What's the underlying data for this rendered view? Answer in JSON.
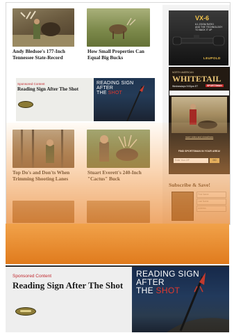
{
  "articles": [
    {
      "title": "Andy Bledsoe's 177-Inch Tennessee State-Record"
    },
    {
      "title": "How Small Properties Can Equal Big Bucks"
    },
    {
      "title": "Top Do's and Don'ts When Trimming Shooting Lanes"
    },
    {
      "title": "Stuart Everett's 240-Inch \"Cactus\" Buck"
    }
  ],
  "sponsored": {
    "label": "Sponsored Content",
    "title": "Reading Sign After The Shot",
    "image_text": [
      "READING SIGN",
      "AFTER",
      "THE ",
      "SHOT"
    ]
  },
  "sidebar": {
    "scope_ad": {
      "heading": "VX-6",
      "line1": "6:1 ZOOM RATIO",
      "line2": "AND THE TECHNOLOGY",
      "line3": "TO BACK IT UP",
      "brand": "LEUPOLD"
    },
    "whitetail_ad": {
      "kicker": "NORTH AMERICAN",
      "title": "WHITETAIL",
      "schedule": "Wednesdays 9:00pm ET",
      "network": "SPORTSMAN",
      "tagline": "Giving Our Whole on SWOTV",
      "more_link": "more video and showtimes",
      "cta": "FIND SPORTSMAN IN YOUR AREA!",
      "zip_placeholder": "Enter Your ZIP",
      "go_label": "GO"
    },
    "subscribe": {
      "title": "Subscribe & Save!",
      "first_name": "First Name",
      "last_name": "Last Name",
      "address": "Address"
    }
  },
  "colors": {
    "accent_orange": "#e8862f",
    "sponsored_red": "#c0272d"
  }
}
